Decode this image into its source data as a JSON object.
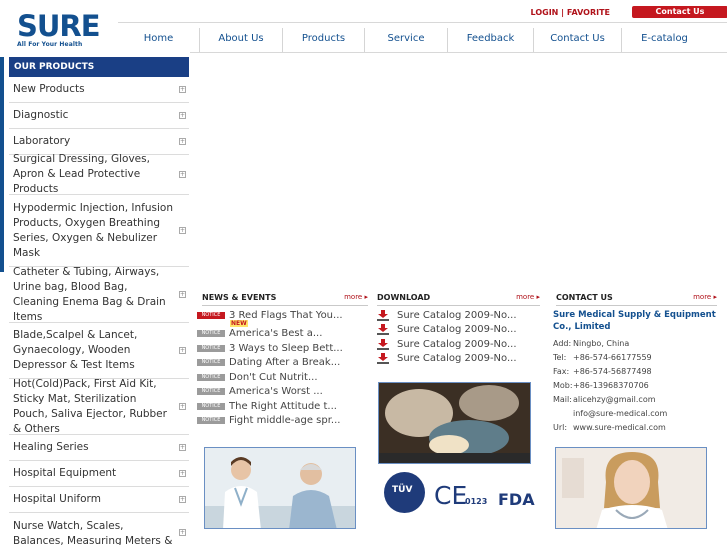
{
  "logo": {
    "word": "SURE",
    "tagline": "All For Your Health"
  },
  "top_links": {
    "login": "LOGIN",
    "separator": "|",
    "favorite": "FAVORITE",
    "contact_button": "Contact Us"
  },
  "nav": [
    "Home",
    "About Us",
    "Products",
    "Service",
    "Feedback",
    "Contact Us",
    "E-catalog"
  ],
  "sidebar": {
    "title": "OUR PRODUCTS",
    "items": [
      "New Products",
      "Diagnostic",
      "Laboratory",
      "Surgical Dressing, Gloves, Apron & Lead Protective Products",
      "Hypodermic Injection, Infusion Products, Oxygen Breathing Series, Oxygen & Nebulizer Mask",
      "Catheter & Tubing, Airways, Urine bag, Blood Bag, Cleaning Enema Bag & Drain Items",
      "Blade,Scalpel & Lancet, Gynaecology, Wooden Depressor & Test Items",
      "Hot(Cold)Pack, First Aid Kit, Sticky Mat, Sterilization Pouch, Saliva Ejector, Rubber & Others",
      "Healing Series",
      "Hospital Equipment",
      "Hospital Uniform",
      "Nurse Watch, Scales, Balances, Measuring Meters & Tapes"
    ]
  },
  "news": {
    "heading": "NEWS & EVENTS",
    "more": "more",
    "badge": "NOTICE",
    "new_tag": "NEW",
    "items": [
      "3 Red Flags That You...",
      "America's Best a...",
      "3 Ways to Sleep Bett...",
      "Dating After a Break...",
      "Don't Cut Nutrit...",
      "America's Worst ...",
      "The Right Attitude t...",
      "Fight middle-age spr..."
    ]
  },
  "download": {
    "heading": "DOWNLOAD",
    "more": "more",
    "items": [
      "Sure Catalog 2009-No...",
      "Sure Catalog 2009-No...",
      "Sure Catalog 2009-No...",
      "Sure Catalog 2009-No..."
    ]
  },
  "contact": {
    "heading": "CONTACT US",
    "more": "more",
    "company": "Sure Medical Supply & Equipment Co., Limited",
    "add_label": "Add:",
    "add": "Ningbo, China",
    "tel_label": "Tel:",
    "tel": "+86-574-66177559",
    "fax_label": "Fax:",
    "fax": "+86-574-56877498",
    "mob_label": "Mob:",
    "mob": "+86-13968370706",
    "mail_label": "Mail:",
    "mail1": "alicehzy@gmail.com",
    "mail2": "info@sure-medical.com",
    "url_label": "Url:",
    "url": "www.sure-medical.com"
  },
  "certs": {
    "tuv": "TÜV",
    "ce": "CE",
    "ce_number": "0123",
    "fda": "FDA"
  },
  "colors": {
    "brand_blue": "#13508f",
    "sidebar_title": "#1a3f85",
    "accent_red": "#c5181f"
  }
}
